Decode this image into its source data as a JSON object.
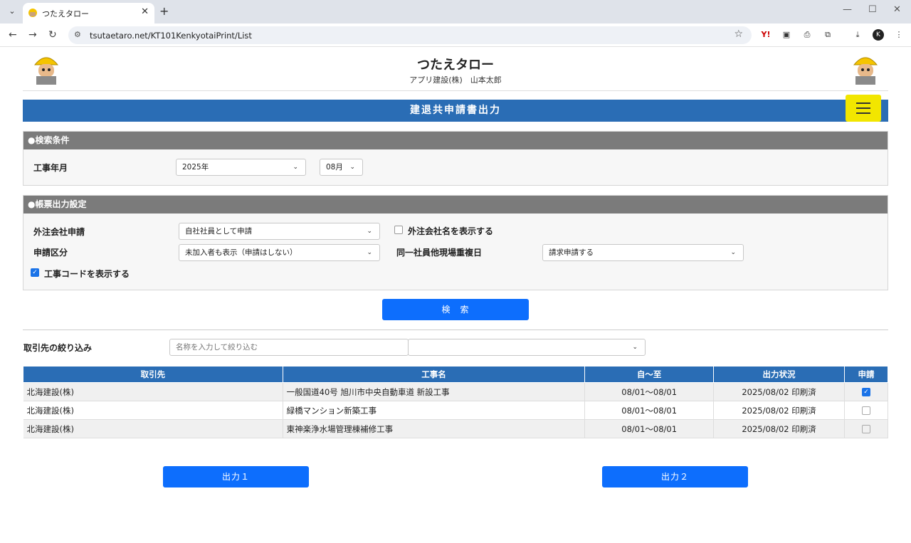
{
  "browser": {
    "tab_title": "つたえタロー",
    "url": "tsutaetaro.net/KT101KenkyotaiPrint/List",
    "profile_initial": "K"
  },
  "header": {
    "app_title": "つたえタロー",
    "company_user": "アプリ建設(株)　山本太郎"
  },
  "page_title": "建退共申請書出力",
  "search_conditions": {
    "heading": "●検索条件",
    "work_month_label": "工事年月",
    "year_value": "2025年",
    "month_value": "08月"
  },
  "output_settings": {
    "heading": "●帳票出力設定",
    "subcontractor_label": "外注会社申請",
    "subcontractor_value": "自社社員として申請",
    "show_subcontractor_name_label": "外注会社名を表示する",
    "show_subcontractor_name_checked": false,
    "application_type_label": "申請区分",
    "application_type_value": "未加入者も表示（申請はしない）",
    "duplicate_day_label": "同一社員他現場重複日",
    "duplicate_day_value": "請求申請する",
    "show_work_code_label": "工事コードを表示する",
    "show_work_code_checked": true
  },
  "search_button": "検　索",
  "filter": {
    "label": "取引先の絞り込み",
    "placeholder": "名称を入力して絞り込む",
    "select_value": ""
  },
  "table": {
    "headers": [
      "取引先",
      "工事名",
      "自～至",
      "出力状況",
      "申請"
    ],
    "rows": [
      {
        "client": "北海建設(株)",
        "work": "一般国道40号 旭川市中央自動車道 新設工事",
        "period": "08/01～08/01",
        "status": "2025/08/02 印刷済",
        "applied": true
      },
      {
        "client": "北海建設(株)",
        "work": "緑橋マンション新築工事",
        "period": "08/01～08/01",
        "status": "2025/08/02 印刷済",
        "applied": false
      },
      {
        "client": "北海建設(株)",
        "work": "東神楽浄水場管理棟補修工事",
        "period": "08/01～08/01",
        "status": "2025/08/02 印刷済",
        "applied": false
      }
    ]
  },
  "output_buttons": [
    "出力１",
    "出力２"
  ],
  "colors": {
    "primary_blue": "#2a6db5",
    "button_blue": "#0d6efd",
    "menu_yellow": "#f2e600",
    "section_gray": "#7b7b7b"
  }
}
